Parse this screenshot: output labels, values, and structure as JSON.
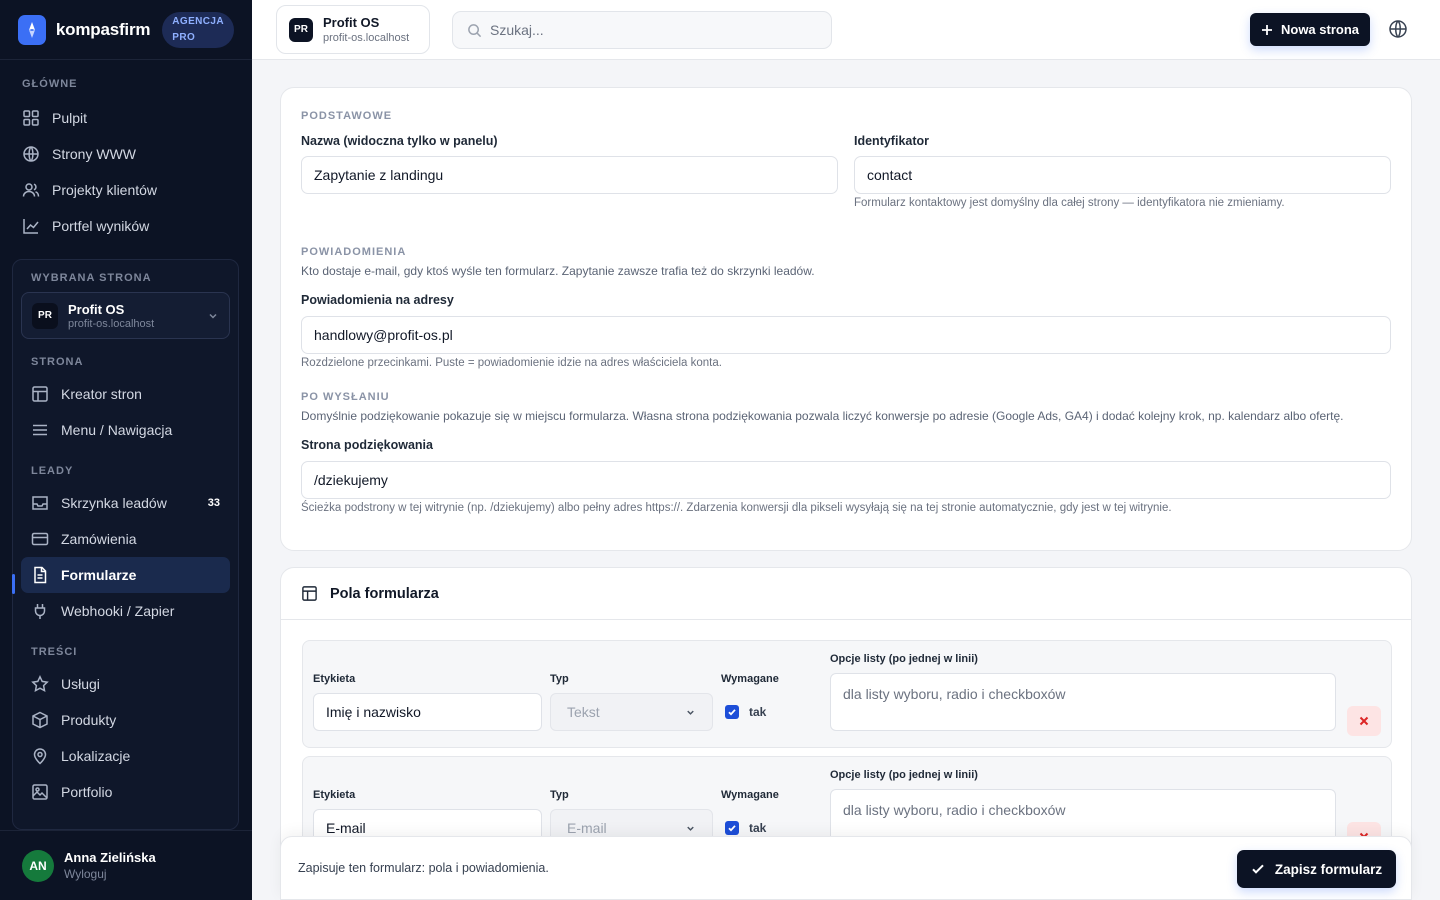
{
  "colors": {
    "sidebar_bg": "#0c1324",
    "accent": "#3b6ff5",
    "danger": "#e11d48"
  },
  "brand": {
    "name": "kompasfirm",
    "badge_line1": "AGENCJA",
    "badge_line2": "PRO"
  },
  "sidebar": {
    "main_title": "GŁÓWNE",
    "main_items": [
      {
        "label": "Pulpit",
        "icon": "grid-icon"
      },
      {
        "label": "Strony WWW",
        "icon": "globe-icon"
      },
      {
        "label": "Projekty klientów",
        "icon": "users-icon"
      },
      {
        "label": "Portfel wyników",
        "icon": "chart-icon"
      }
    ],
    "selected_site_title": "WYBRANA STRONA",
    "selected_site": {
      "badge": "PR",
      "name": "Profit OS",
      "domain": "profit-os.localhost"
    },
    "site_title": "STRONA",
    "site_items": [
      {
        "label": "Kreator stron"
      },
      {
        "label": "Menu / Nawigacja"
      }
    ],
    "leads_title": "LEADY",
    "leads_items": [
      {
        "label": "Skrzynka leadów",
        "count": "33"
      },
      {
        "label": "Zamówienia"
      },
      {
        "label": "Formularze"
      },
      {
        "label": "Webhooki / Zapier"
      }
    ],
    "content_title": "TREŚCI",
    "content_items": [
      {
        "label": "Usługi"
      },
      {
        "label": "Produkty"
      },
      {
        "label": "Lokalizacje"
      },
      {
        "label": "Portfolio"
      }
    ],
    "user": {
      "initials": "AN",
      "name": "Anna Zielińska",
      "logout": "Wyloguj"
    }
  },
  "topbar": {
    "site": {
      "badge": "PR",
      "name": "Profit OS",
      "domain": "profit-os.localhost"
    },
    "search_placeholder": "Szukaj...",
    "new_page": "Nowa strona"
  },
  "basic": {
    "section": "PODSTAWOWE",
    "name_label": "Nazwa (widoczna tylko w panelu)",
    "name_value": "Zapytanie z landingu",
    "id_label": "Identyfikator",
    "id_value": "contact",
    "id_hint": "Formularz kontaktowy jest domyślny dla całej strony — identyfikatora nie zmieniamy."
  },
  "notifications": {
    "section": "POWIADOMIENIA",
    "desc": "Kto dostaje e-mail, gdy ktoś wyśle ten formularz. Zapytanie zawsze trafia też do skrzynki leadów.",
    "label": "Powiadomienia na adresy",
    "value": "handlowy@profit-os.pl",
    "hint": "Rozdzielone przecinkami. Puste = powiadomienie idzie na adres właściciela konta."
  },
  "after_submit": {
    "section": "PO WYSŁANIU",
    "desc": "Domyślnie podziękowanie pokazuje się w miejscu formularza. Własna strona podziękowania pozwala liczyć konwersje po adresie (Google Ads, GA4) i dodać kolejny krok, np. kalendarz albo ofertę.",
    "label": "Strona podziękowania",
    "value": "/dziekujemy",
    "hint": "Ścieżka podstrony w tej witrynie (np. /dziekujemy) albo pełny adres https://. Zdarzenia konwersji dla pikseli wysyłają się na tej stronie automatycznie, gdy jest w tej witrynie."
  },
  "fields": {
    "title": "Pola formularza",
    "label_col": "Etykieta",
    "type_col": "Typ",
    "required_col": "Wymagane",
    "options_col": "Opcje listy (po jednej w linii)",
    "options_placeholder": "dla listy wyboru, radio i checkboxów",
    "yes": "tak",
    "rows": [
      {
        "label": "Imię i nazwisko",
        "type": "Tekst"
      },
      {
        "label": "E-mail",
        "type": "E-mail"
      }
    ]
  },
  "savebar": {
    "message": "Zapisuje ten formularz: pola i powiadomienia.",
    "button": "Zapisz formularz"
  }
}
